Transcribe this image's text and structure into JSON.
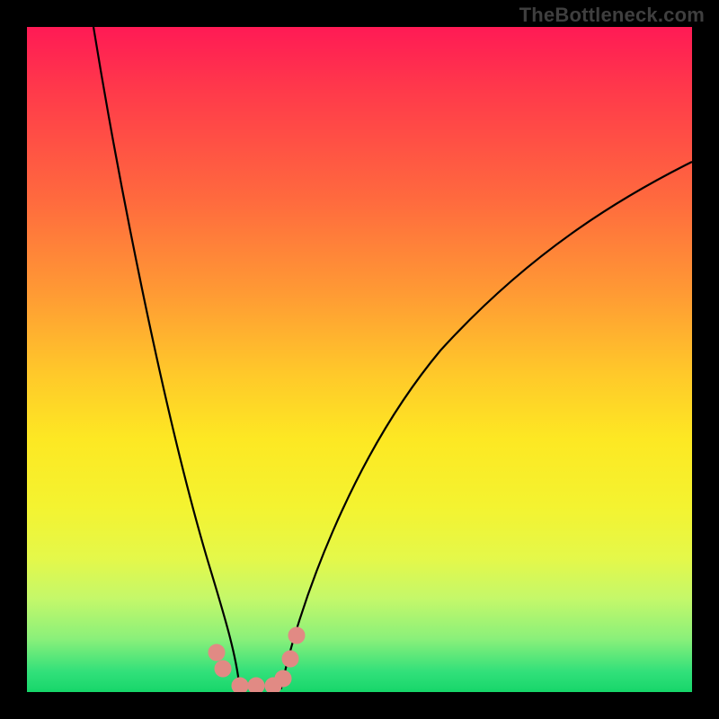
{
  "watermark": "TheBottleneck.com",
  "chart_data": {
    "type": "line",
    "title": "",
    "xlabel": "",
    "ylabel": "",
    "xlim": [
      0,
      1
    ],
    "ylim": [
      0,
      1
    ],
    "series": [
      {
        "name": "left-curve",
        "x": [
          0.1,
          0.14,
          0.18,
          0.22,
          0.26,
          0.3,
          0.32
        ],
        "y": [
          1.0,
          0.72,
          0.48,
          0.28,
          0.13,
          0.03,
          0.0
        ]
      },
      {
        "name": "right-curve",
        "x": [
          0.38,
          0.42,
          0.48,
          0.56,
          0.66,
          0.78,
          0.9,
          1.0
        ],
        "y": [
          0.0,
          0.05,
          0.17,
          0.32,
          0.48,
          0.62,
          0.72,
          0.8
        ]
      },
      {
        "name": "valley-flat",
        "x": [
          0.32,
          0.38
        ],
        "y": [
          0.0,
          0.0
        ]
      }
    ],
    "marker_points": {
      "x": [
        0.285,
        0.295,
        0.32,
        0.345,
        0.37,
        0.385,
        0.395,
        0.405
      ],
      "y": [
        0.06,
        0.035,
        0.0,
        0.0,
        0.0,
        0.02,
        0.05,
        0.085
      ]
    },
    "gradient_stops": [
      {
        "pos": 0.0,
        "color": "#ff1a55"
      },
      {
        "pos": 0.4,
        "color": "#ff9a34"
      },
      {
        "pos": 0.62,
        "color": "#fde823"
      },
      {
        "pos": 0.86,
        "color": "#c4f86a"
      },
      {
        "pos": 1.0,
        "color": "#17d66a"
      }
    ]
  }
}
